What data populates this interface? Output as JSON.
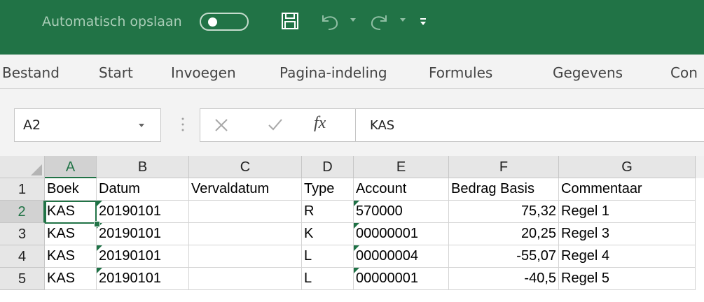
{
  "quick_access": {
    "autosave_label": "Automatisch opslaan",
    "autosave_state": "off"
  },
  "ribbon": {
    "tabs": [
      "Bestand",
      "Start",
      "Invoegen",
      "Pagina-indeling",
      "Formules",
      "Gegevens",
      "Con"
    ]
  },
  "formula_bar": {
    "name_box": "A2",
    "formula": "KAS"
  },
  "sheet": {
    "columns": [
      "A",
      "B",
      "C",
      "D",
      "E",
      "F",
      "G"
    ],
    "selected_column": "A",
    "selected_row": "2",
    "row_numbers": [
      "1",
      "2",
      "3",
      "4",
      "5"
    ],
    "rows": [
      [
        "Boek",
        "Datum",
        "Vervaldatum",
        "Type",
        "Account",
        "Bedrag Basis",
        "Commentaar"
      ],
      [
        "KAS",
        "20190101",
        "",
        "R",
        "570000",
        "75,32",
        "Regel 1"
      ],
      [
        "KAS",
        "20190101",
        "",
        "K",
        "00000001",
        "20,25",
        "Regel 3"
      ],
      [
        "KAS",
        "20190101",
        "",
        "L",
        "00000004",
        "-55,07",
        "Regel 4"
      ],
      [
        "KAS",
        "20190101",
        "",
        "L",
        "00000001",
        "-40,5",
        "Regel 5"
      ]
    ]
  },
  "colors": {
    "title_bar": "#217346",
    "accent": "#217346",
    "text_number_flag": "#1e7145"
  }
}
